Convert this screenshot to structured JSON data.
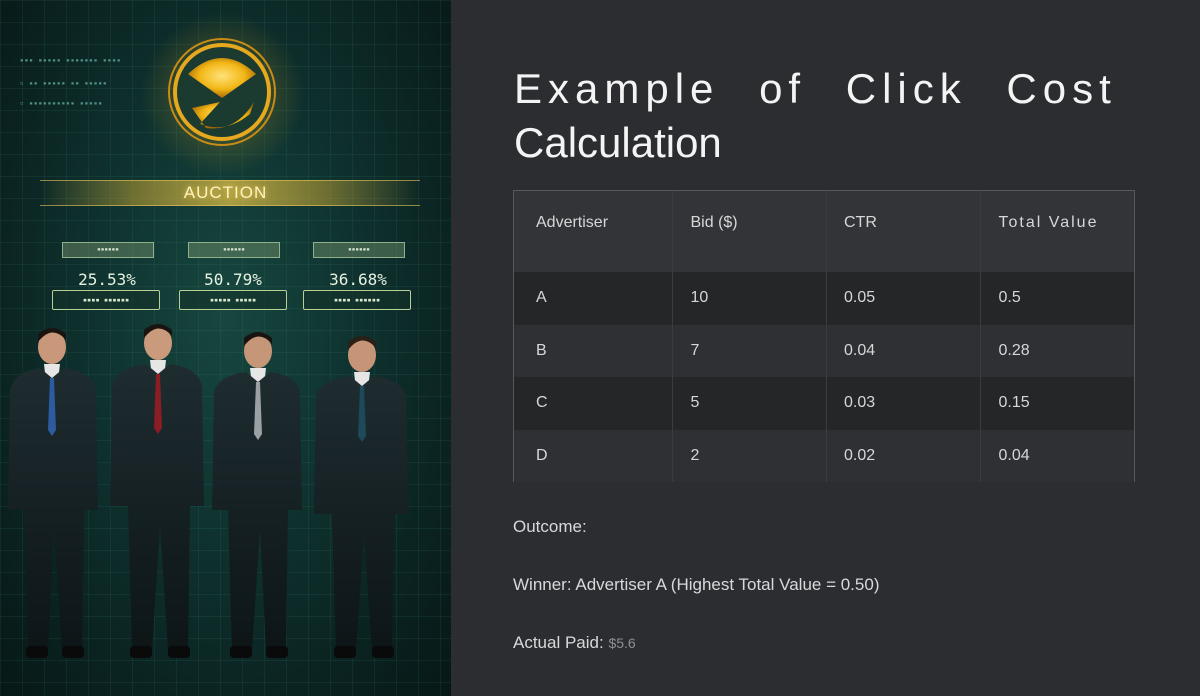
{
  "illustration": {
    "banner": "AUCTION",
    "stats": [
      {
        "value": "25.53%"
      },
      {
        "value": "50.79%"
      },
      {
        "value": "36.68%"
      }
    ]
  },
  "slide": {
    "title_line1": "Example of Click Cost",
    "title_line2": "Calculation"
  },
  "table": {
    "headers": [
      "Advertiser",
      "Bid ($)",
      "CTR",
      "Total Value"
    ],
    "rows": [
      [
        "A",
        "10",
        "0.05",
        "0.5"
      ],
      [
        "B",
        "7",
        "0.04",
        "0.28"
      ],
      [
        "C",
        "5",
        "0.03",
        "0.15"
      ],
      [
        "D",
        "2",
        "0.02",
        "0.04"
      ]
    ]
  },
  "outcome": {
    "heading": "Outcome:",
    "winner": "Winner: Advertiser A (Highest Total Value = 0.50)",
    "paid_label": "Actual Paid:",
    "paid_value": "$5.6"
  },
  "colors": {
    "slide_bg": "#2b2d30",
    "coin_gold": "#f2b716",
    "illustration_teal": "#0f3330"
  }
}
